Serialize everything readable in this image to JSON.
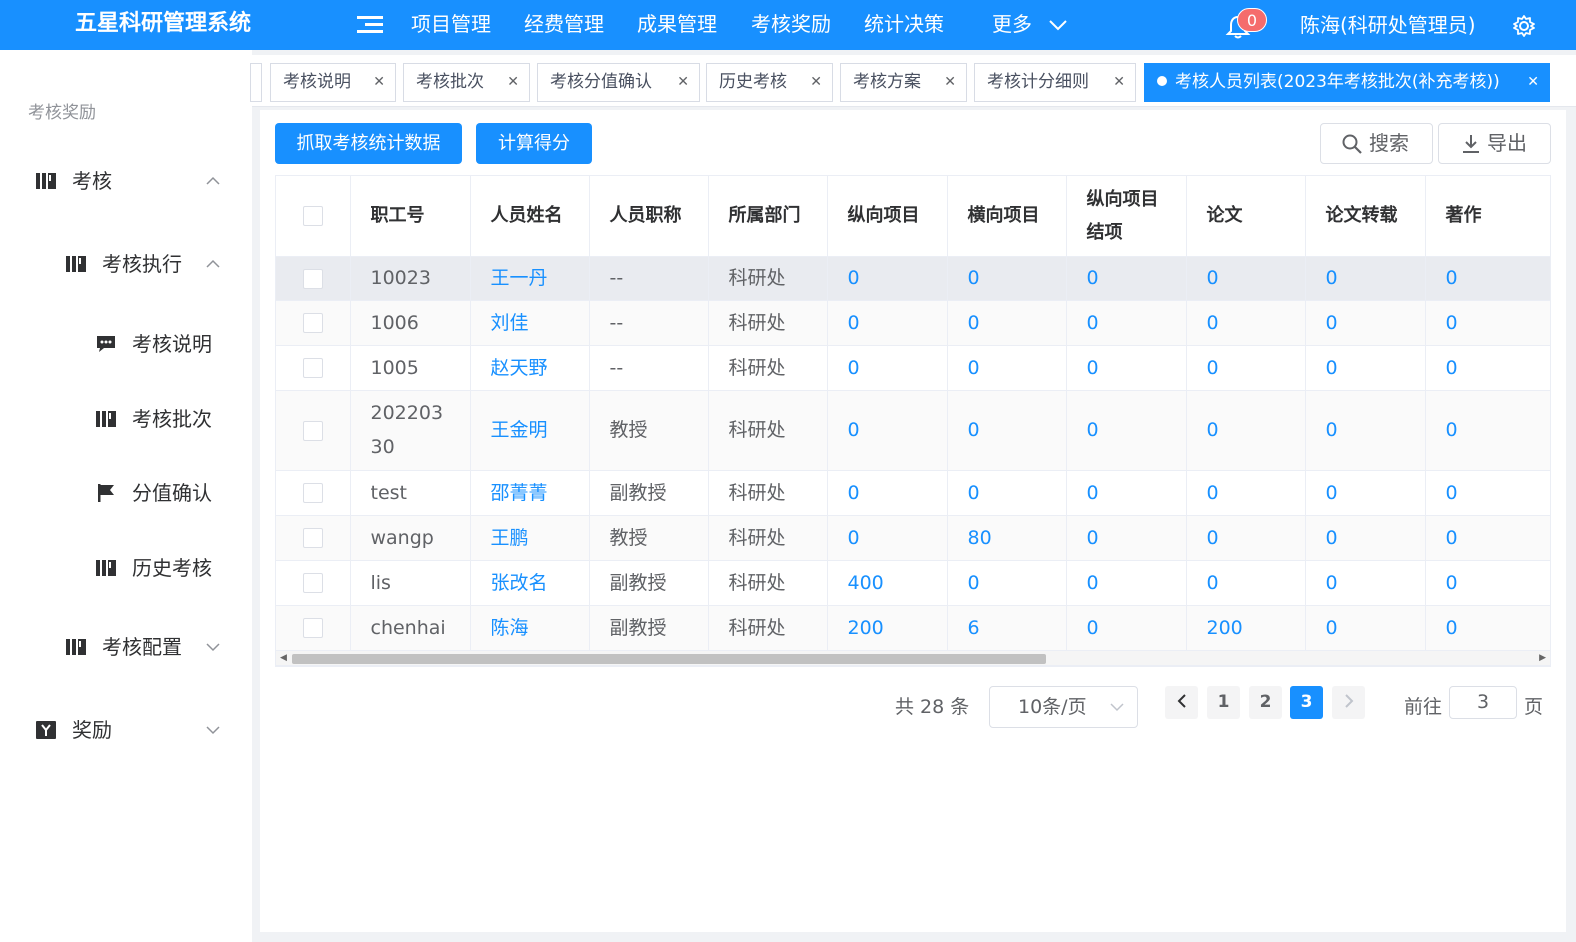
{
  "header": {
    "brand": "五星科研管理系统",
    "nav": [
      "项目管理",
      "经费管理",
      "成果管理",
      "考核奖励",
      "统计决策"
    ],
    "more": "更多",
    "notification_count": "0",
    "user": "陈海(科研处管理员)"
  },
  "sidebar": {
    "title": "考核奖励",
    "items": [
      {
        "label": "考核",
        "icon": "bars-icon"
      },
      {
        "label": "考核执行",
        "icon": "bars-icon"
      },
      {
        "label": "考核说明",
        "icon": "comment-icon"
      },
      {
        "label": "考核批次",
        "icon": "bars-icon"
      },
      {
        "label": "分值确认",
        "icon": "flag-icon"
      },
      {
        "label": "历史考核",
        "icon": "bars-icon"
      },
      {
        "label": "考核配置",
        "icon": "bars-icon"
      },
      {
        "label": "奖励",
        "icon": "yen-icon"
      }
    ]
  },
  "tabs": [
    {
      "label": "考核说明"
    },
    {
      "label": "考核批次"
    },
    {
      "label": "考核分值确认"
    },
    {
      "label": "历史考核"
    },
    {
      "label": "考核方案"
    },
    {
      "label": "考核计分细则"
    },
    {
      "label": "考核人员列表(2023年考核批次(补充考核))",
      "active": true
    }
  ],
  "toolbar": {
    "fetch_label": "抓取考核统计数据",
    "calc_label": "计算得分",
    "search_label": "搜索",
    "export_label": "导出"
  },
  "table": {
    "columns": [
      "职工号",
      "人员姓名",
      "人员职称",
      "所属部门",
      "纵向项目",
      "横向项目",
      "纵向项目结项",
      "论文",
      "论文转载",
      "著作"
    ],
    "rows": [
      [
        "10023",
        "王一丹",
        "--",
        "科研处",
        "0",
        "0",
        "0",
        "0",
        "0",
        "0"
      ],
      [
        "1006",
        "刘佳",
        "--",
        "科研处",
        "0",
        "0",
        "0",
        "0",
        "0",
        "0"
      ],
      [
        "1005",
        "赵天野",
        "--",
        "科研处",
        "0",
        "0",
        "0",
        "0",
        "0",
        "0"
      ],
      [
        "20220330",
        "王金明",
        "教授",
        "科研处",
        "0",
        "0",
        "0",
        "0",
        "0",
        "0"
      ],
      [
        "test",
        "邵菁菁",
        "副教授",
        "科研处",
        "0",
        "0",
        "0",
        "0",
        "0",
        "0"
      ],
      [
        "wangp",
        "王鹏",
        "教授",
        "科研处",
        "0",
        "80",
        "0",
        "0",
        "0",
        "0"
      ],
      [
        "lis",
        "张改名",
        "副教授",
        "科研处",
        "400",
        "0",
        "0",
        "0",
        "0",
        "0"
      ],
      [
        "chenhai",
        "陈海",
        "副教授",
        "科研处",
        "200",
        "6",
        "0",
        "200",
        "0",
        "0"
      ]
    ]
  },
  "pagination": {
    "total": "共 28 条",
    "page_size": "10条/页",
    "pages": [
      "1",
      "2",
      "3"
    ],
    "current": "3",
    "goto_prefix": "前往",
    "goto_value": "3",
    "goto_suffix": "页"
  },
  "colors": {
    "primary": "#1890ff",
    "badge": "#f56c6c"
  }
}
